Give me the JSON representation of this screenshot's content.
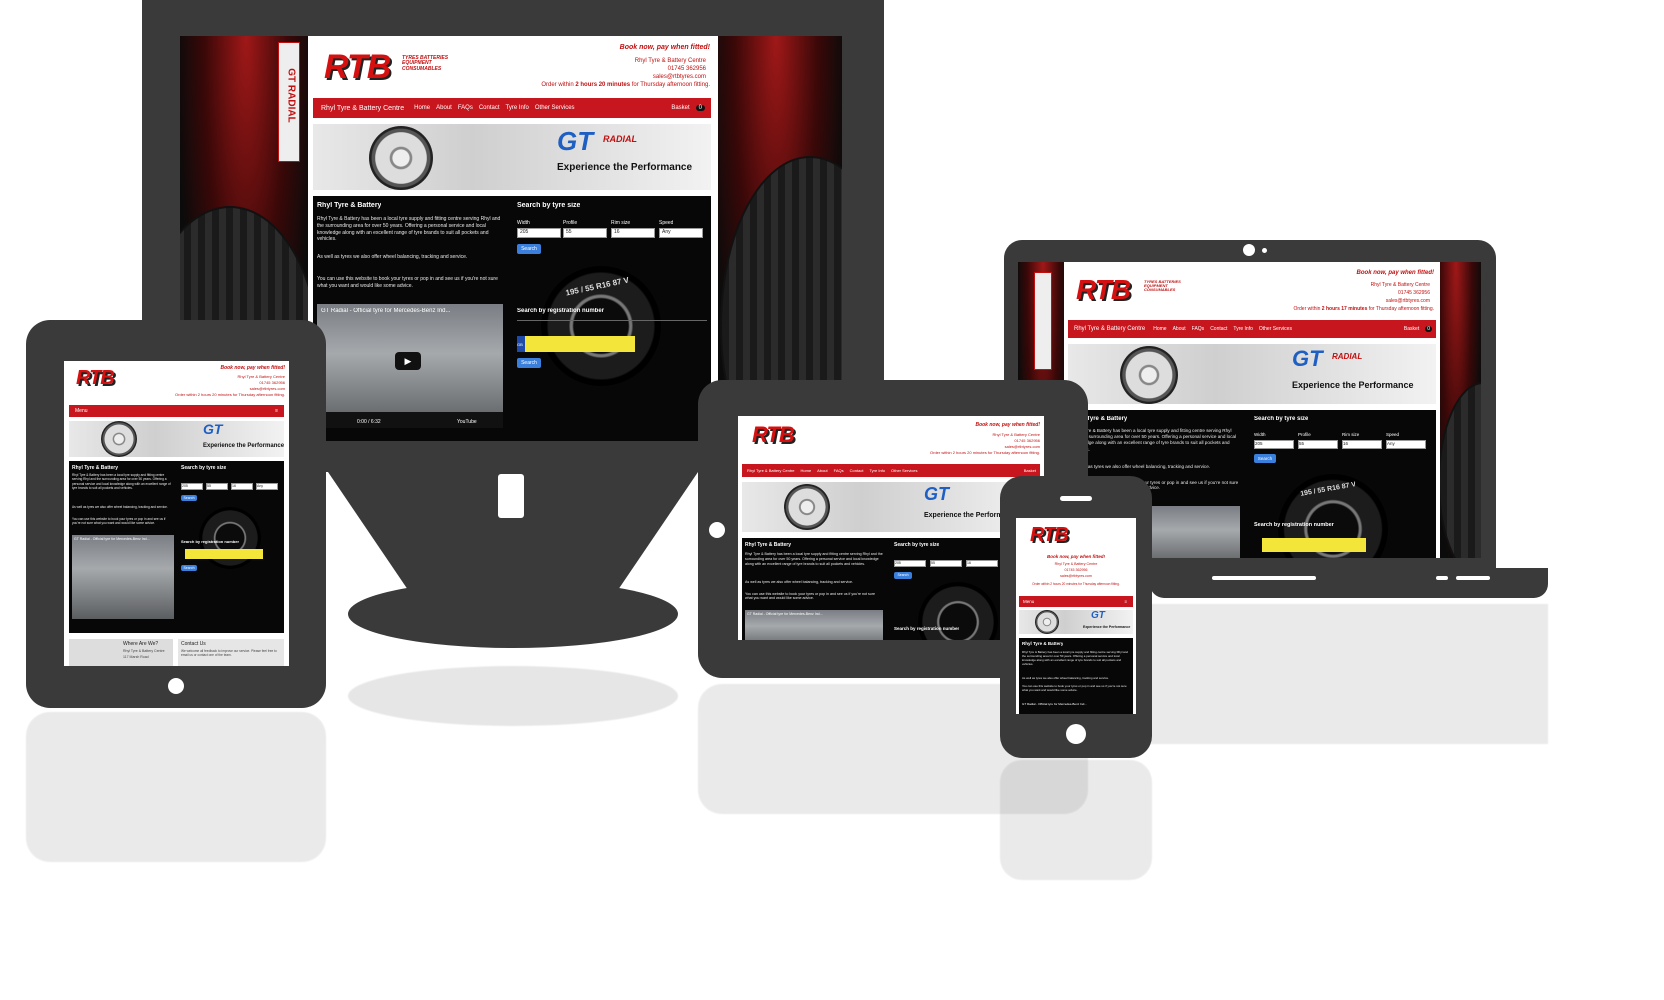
{
  "site": {
    "logo": "RTB",
    "logo_tag": "TYRES BATTERIES EQUIPMENT CONSUMABLES",
    "promo": "Book now, pay when fitted!",
    "company": "Rhyl Tyre & Battery Centre",
    "phone": "01745 362956",
    "email": "sales@rtbtyres.com",
    "order_prefix": "Order within",
    "order_time_desktop": "2 hours 20 minutes",
    "order_time_laptop": "2 hours 17 minutes",
    "order_suffix": "for Thursday afternoon fitting.",
    "order_line_short": "Order within 2 hours 20 minutes for Thursday afternoon fitting.",
    "nav_brand": "Rhyl Tyre & Battery Centre",
    "nav": [
      "Home",
      "About",
      "FAQs",
      "Contact",
      "Tyre Info",
      "Other Services"
    ],
    "basket": "Basket",
    "basket_count": "0",
    "menu": "Menu",
    "banner_brand": "GT",
    "banner_brand_sub": "RADIAL",
    "banner_slogan": "Experience the Performance",
    "side_brand": "GT RADIAL",
    "intro_title": "Rhyl Tyre & Battery",
    "intro_p1": "Rhyl Tyre & Battery has been a local tyre supply and fitting centre serving Rhyl and the surrounding area for over 50 years. Offering a personal service and local knowledge along with an excellent range of tyre brands to suit all pockets and vehicles.",
    "intro_p2": "As well as tyres we also offer wheel balancing, tracking and service.",
    "intro_p3": "You can use this website to book your tyres or pop in and see us if you're not sure what you want and would like some advice.",
    "video_title": "GT Radial - Official tyre for Mercedes-Benz Ind...",
    "video_time": "0:00 / 6:32",
    "video_brand": "YouTube",
    "tyre_search_title": "Search by tyre size",
    "fields": [
      "Width",
      "Profile",
      "Rim size",
      "Speed"
    ],
    "values": [
      "205",
      "55",
      "16",
      "Any"
    ],
    "search_button": "Search",
    "tyre_marking": "195 / 55 R16 87 V",
    "reg_title": "Search by registration number",
    "reg_prefix": "GB",
    "where_title": "Where Are We?",
    "where_address_1": "Rhyl Tyre & Battery Centre",
    "where_address_2": "117 Marsh Road",
    "contact_title": "Contact Us",
    "contact_text": "We welcome all feedback to improve our service. Please feel free to email us or contact one of the team."
  },
  "colors": {
    "brand_red": "#c8161e",
    "panel_black": "#070707",
    "button_blue": "#3a7fdc",
    "reg_yellow": "#f4e53a",
    "device_grey": "#3a3a3a",
    "gt_blue": "#1e5fc4"
  }
}
